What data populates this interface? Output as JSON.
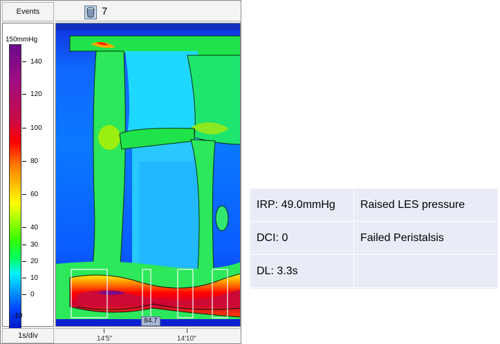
{
  "viewer": {
    "events_label": "Events",
    "event_count": "7",
    "event_icon": "bucket-icon",
    "scale": {
      "max_label": "150mmHg",
      "min_label": "-10",
      "ticks": [
        "140",
        "120",
        "100",
        "80",
        "60",
        "40",
        "30",
        "20",
        "10",
        "0"
      ]
    },
    "marker_value": "84.7",
    "time_scale": "1s/div",
    "time_ticks": [
      "14'5\"",
      "14'10\""
    ]
  },
  "results": {
    "rows": [
      {
        "metric": "IRP: 49.0mmHg",
        "finding": "Raised LES pressure"
      },
      {
        "metric": "DCI: 0",
        "finding": "Failed Peristalsis"
      },
      {
        "metric": "DL: 3.3s",
        "finding": ""
      }
    ]
  }
}
